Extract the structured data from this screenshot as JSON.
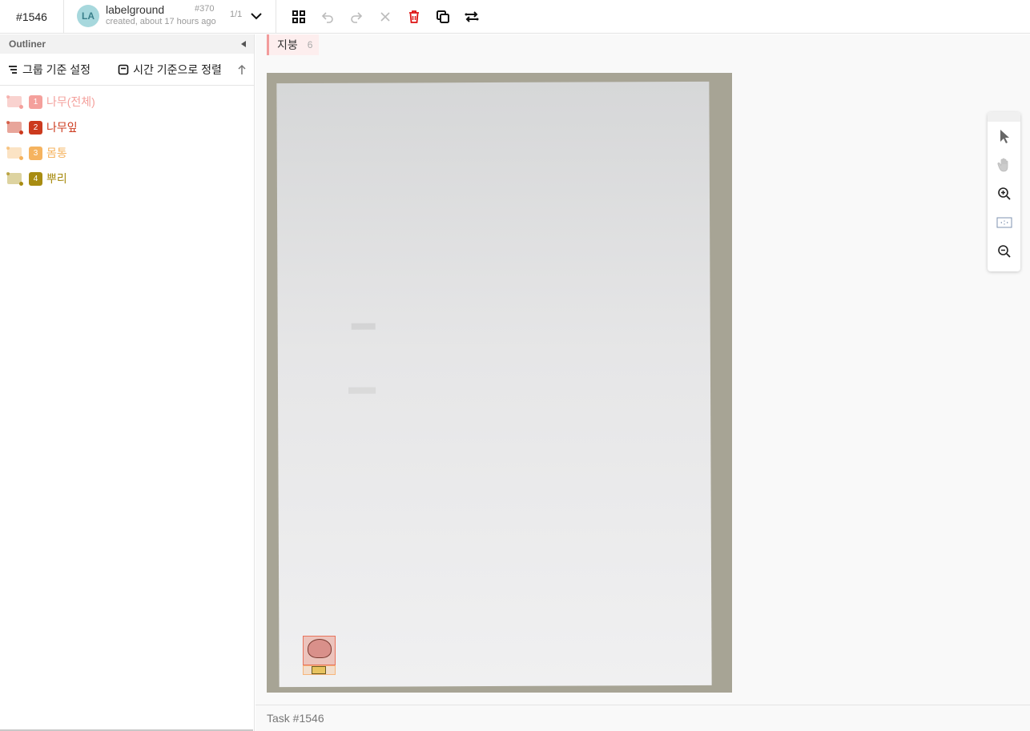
{
  "header": {
    "task_id": "#1546",
    "annotator": {
      "initials": "LA",
      "name": "labelground",
      "created": "created, about 17 hours ago",
      "annotation_id": "#370",
      "page_count": "1/1"
    },
    "toolbar_icons": [
      "grid-icon",
      "undo-icon",
      "redo-icon",
      "close-icon",
      "delete-icon",
      "copy-icon",
      "swap-icon"
    ]
  },
  "sidebar": {
    "title": "Outliner",
    "group_label": "그룹 기준 설정",
    "sort_label": "시간 기준으로 정렬",
    "labels": [
      {
        "num": "1",
        "name": "나무(전체)",
        "color": "#f4a09c"
      },
      {
        "num": "2",
        "name": "나무잎",
        "color": "#cc3a1e"
      },
      {
        "num": "3",
        "name": "몸통",
        "color": "#f5b35f"
      },
      {
        "num": "4",
        "name": "뿌리",
        "color": "#a88c12"
      }
    ]
  },
  "main": {
    "class_tag": {
      "name": "지붕",
      "count": "6"
    },
    "footer_text": "Task #1546"
  },
  "zoom_tools": [
    "select-icon",
    "pan-icon",
    "zoom-in-icon",
    "fit-icon",
    "zoom-out-icon"
  ]
}
